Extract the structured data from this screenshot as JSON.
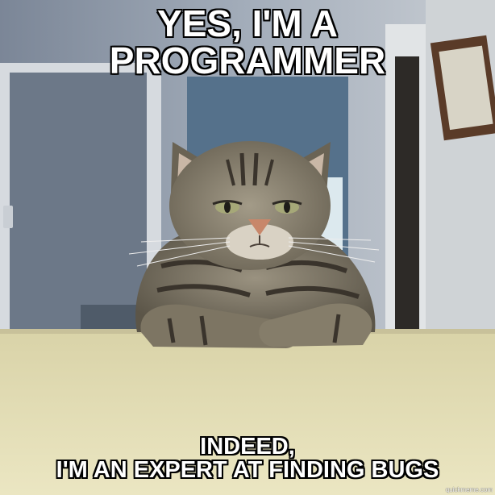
{
  "meme": {
    "top_text": "YES, I'M A\nPROGRAMMER",
    "bottom_text": "INDEED,\nI'M AN EXPERT AT FINDING BUGS",
    "watermark": "quickmeme.com"
  },
  "colors": {
    "wall": "#8c98a8",
    "counter": "#e4dfb6",
    "cat_fur": "#7b7466",
    "caption_text": "#ffffff",
    "caption_outline": "#000000"
  }
}
